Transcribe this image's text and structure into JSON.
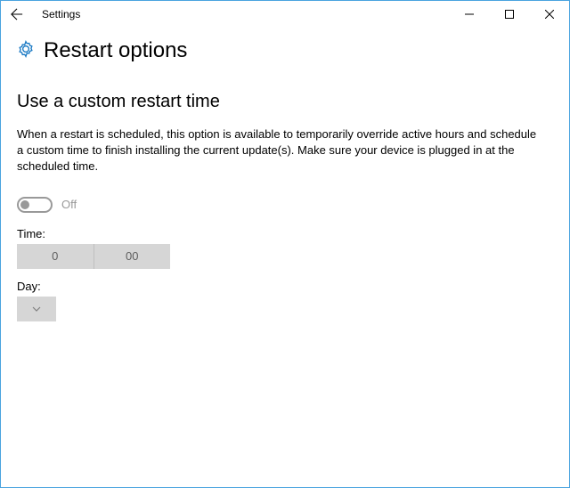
{
  "titlebar": {
    "app_name": "Settings"
  },
  "header": {
    "icon": "gear-icon",
    "title": "Restart options"
  },
  "section": {
    "title": "Use a custom restart time",
    "description": "When a restart is scheduled, this option is available to temporarily override active hours and schedule a custom time to finish installing the current update(s). Make sure your device is plugged in at the scheduled time."
  },
  "toggle": {
    "state": "off",
    "label": "Off"
  },
  "time": {
    "label": "Time:",
    "hour": "0",
    "minute": "00"
  },
  "day": {
    "label": "Day:",
    "value": ""
  }
}
